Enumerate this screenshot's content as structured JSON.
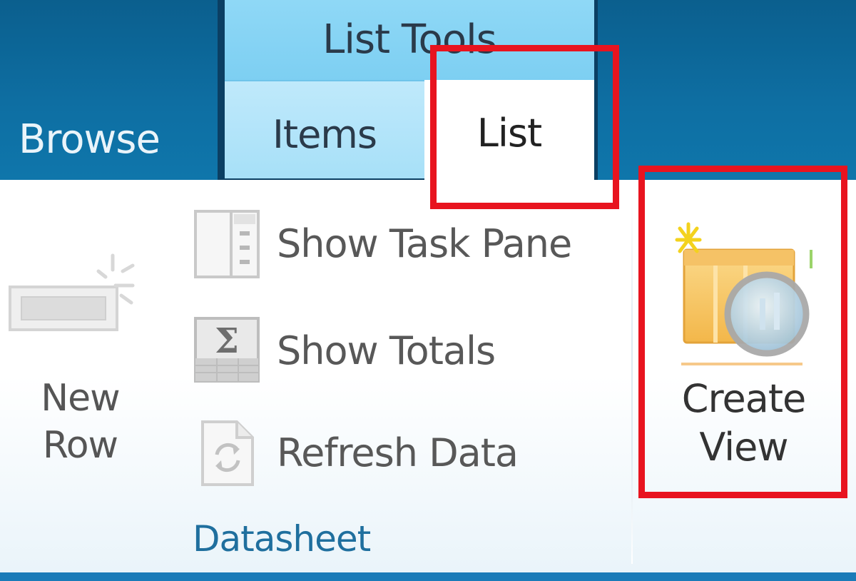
{
  "tabs": {
    "browse": "Browse",
    "context_group_title": "List Tools",
    "items": "Items",
    "list": "List"
  },
  "datasheet_group": {
    "new_row_line1": "New",
    "new_row_line2": "Row",
    "commands": [
      {
        "label": "Show Task Pane",
        "icon": "task-pane-icon"
      },
      {
        "label": "Show Totals",
        "icon": "totals-sigma-icon"
      },
      {
        "label": "Refresh Data",
        "icon": "refresh-icon"
      }
    ],
    "group_label": "Datasheet"
  },
  "create_view": {
    "line1": "Create",
    "line2": "View",
    "icon": "create-view-icon"
  },
  "colors": {
    "ribbon_blue": "#0e6fa3",
    "context_tab": "#8fd8f6",
    "highlight_box": "#e8141f",
    "group_label": "#1f6f9e"
  }
}
